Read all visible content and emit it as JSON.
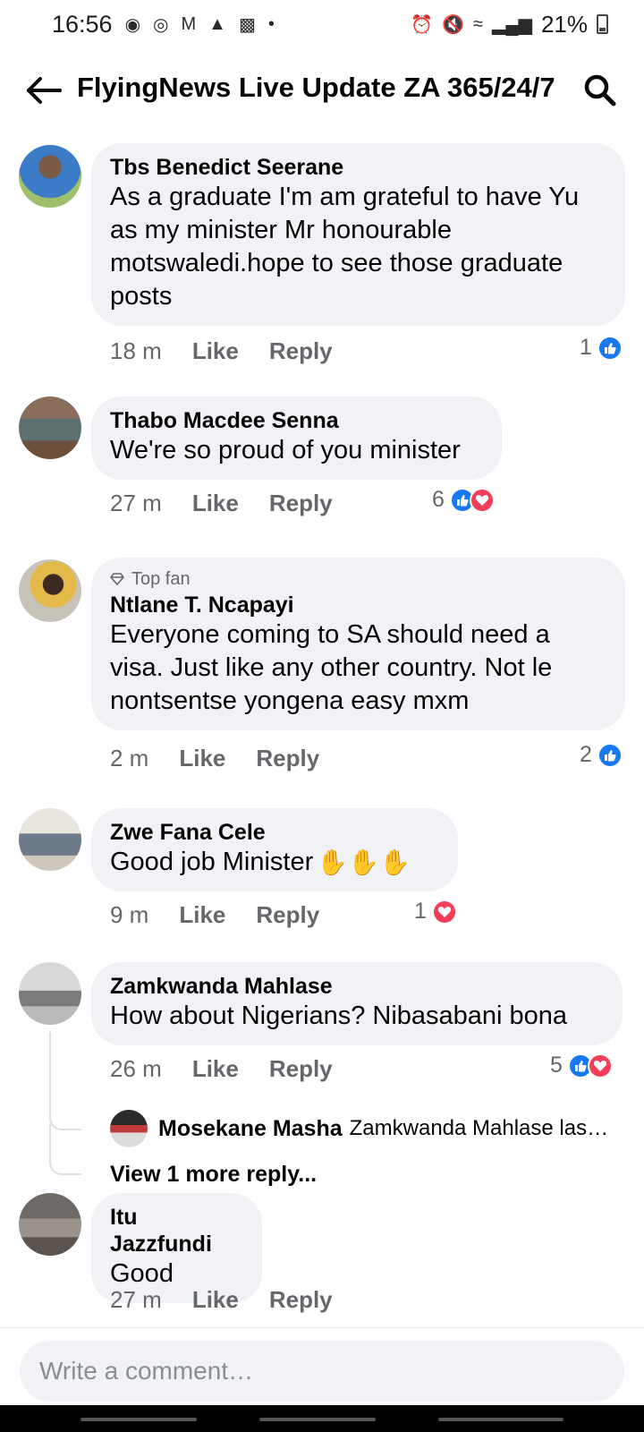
{
  "status_bar": {
    "time": "16:56",
    "battery": "21%"
  },
  "header": {
    "title": "FlyingNews Live Update ZA 365/24/7"
  },
  "comments": [
    {
      "author": "Tbs Benedict Seerane",
      "text": "As a graduate I'm am grateful to have Yu as my minister Mr honourable motswaledi.hope to see those graduate posts",
      "time": "18 m",
      "like": "Like",
      "reply": "Reply",
      "reaction_count": "1",
      "reactions": [
        "like"
      ]
    },
    {
      "author": "Thabo Macdee Senna",
      "text": "We're so proud of you minister",
      "time": "27 m",
      "like": "Like",
      "reply": "Reply",
      "reaction_count": "6",
      "reactions": [
        "like",
        "love"
      ]
    },
    {
      "badge": "Top fan",
      "author": "Ntlane T. Ncapayi",
      "text": "Everyone coming to SA should need a visa. Just like any other country. Not le nontsentse yongena easy mxm",
      "time": "2 m",
      "like": "Like",
      "reply": "Reply",
      "reaction_count": "2",
      "reactions": [
        "like"
      ]
    },
    {
      "author": "Zwe Fana Cele",
      "text": "Good job Minister",
      "time": "9 m",
      "like": "Like",
      "reply": "Reply",
      "reaction_count": "1",
      "reactions": [
        "love"
      ],
      "emoji": "clapping-hands x3"
    },
    {
      "author": "Zamkwanda Mahlase",
      "text": "How about Nigerians?  Nibasabani bona",
      "time": "26 m",
      "like": "Like",
      "reply": "Reply",
      "reaction_count": "5",
      "reactions": [
        "like",
        "love"
      ],
      "reply_preview": {
        "author": "Mosekane Masha",
        "text": "Zamkwanda Mahlase las…"
      },
      "view_more": "View 1 more reply..."
    },
    {
      "author": "Itu Jazzfundi",
      "text": "Good",
      "time": "27 m",
      "like": "Like",
      "reply": "Reply"
    }
  ],
  "composer": {
    "placeholder": "Write a comment…"
  },
  "colors": {
    "like": "#1877f2",
    "love": "#f33e58",
    "bubble": "#f0f2f5",
    "secondary_text": "#65676b"
  }
}
